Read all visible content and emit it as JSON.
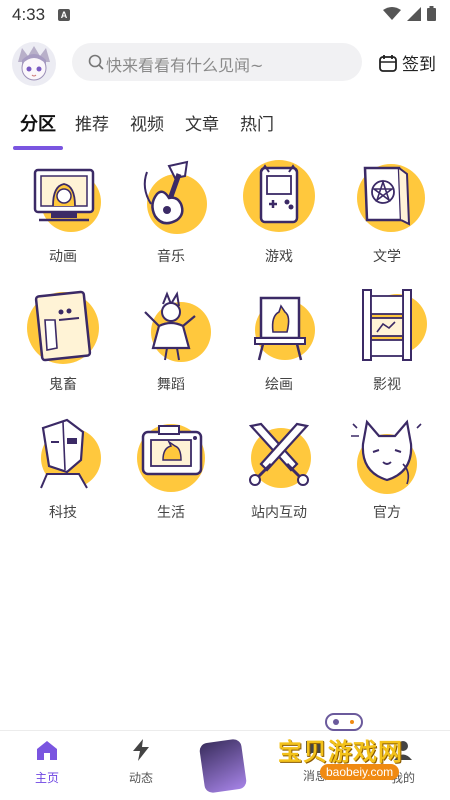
{
  "status_bar": {
    "time": "4:33",
    "notif_glyph": "A"
  },
  "header": {
    "search": {
      "placeholder": "快来看看有什么见闻~"
    },
    "signin_label": "签到"
  },
  "tabs": [
    {
      "label": "分区",
      "active": true
    },
    {
      "label": "推荐"
    },
    {
      "label": "视频"
    },
    {
      "label": "文章"
    },
    {
      "label": "热门"
    }
  ],
  "categories": [
    {
      "label": "动画",
      "icon": "monitor-anime-icon"
    },
    {
      "label": "音乐",
      "icon": "guitar-icon"
    },
    {
      "label": "游戏",
      "icon": "gameboy-icon"
    },
    {
      "label": "文学",
      "icon": "book-pentagram-icon"
    },
    {
      "label": "鬼畜",
      "icon": "photo-frame-icon"
    },
    {
      "label": "舞蹈",
      "icon": "dancer-icon"
    },
    {
      "label": "绘画",
      "icon": "easel-icon"
    },
    {
      "label": "影视",
      "icon": "film-strip-icon"
    },
    {
      "label": "科技",
      "icon": "cyborg-icon"
    },
    {
      "label": "生活",
      "icon": "camera-icon"
    },
    {
      "label": "站内互动",
      "icon": "crossed-swords-icon"
    },
    {
      "label": "官方",
      "icon": "cat-girl-icon"
    }
  ],
  "bottom_nav": [
    {
      "label": "主页",
      "icon": "home-icon",
      "active": true
    },
    {
      "label": "动态",
      "icon": "lightning-icon"
    },
    {
      "label": "",
      "icon": "center-media-icon"
    },
    {
      "label": "消息",
      "icon": "message-icon"
    },
    {
      "label": "我的",
      "icon": "profile-icon"
    }
  ],
  "watermark": {
    "text": "宝贝游戏网",
    "url": "baobeiy.com"
  },
  "colors": {
    "accent": "#7a55e0",
    "icon_fill": "#ffc83d",
    "icon_stroke": "#3b2a66"
  }
}
